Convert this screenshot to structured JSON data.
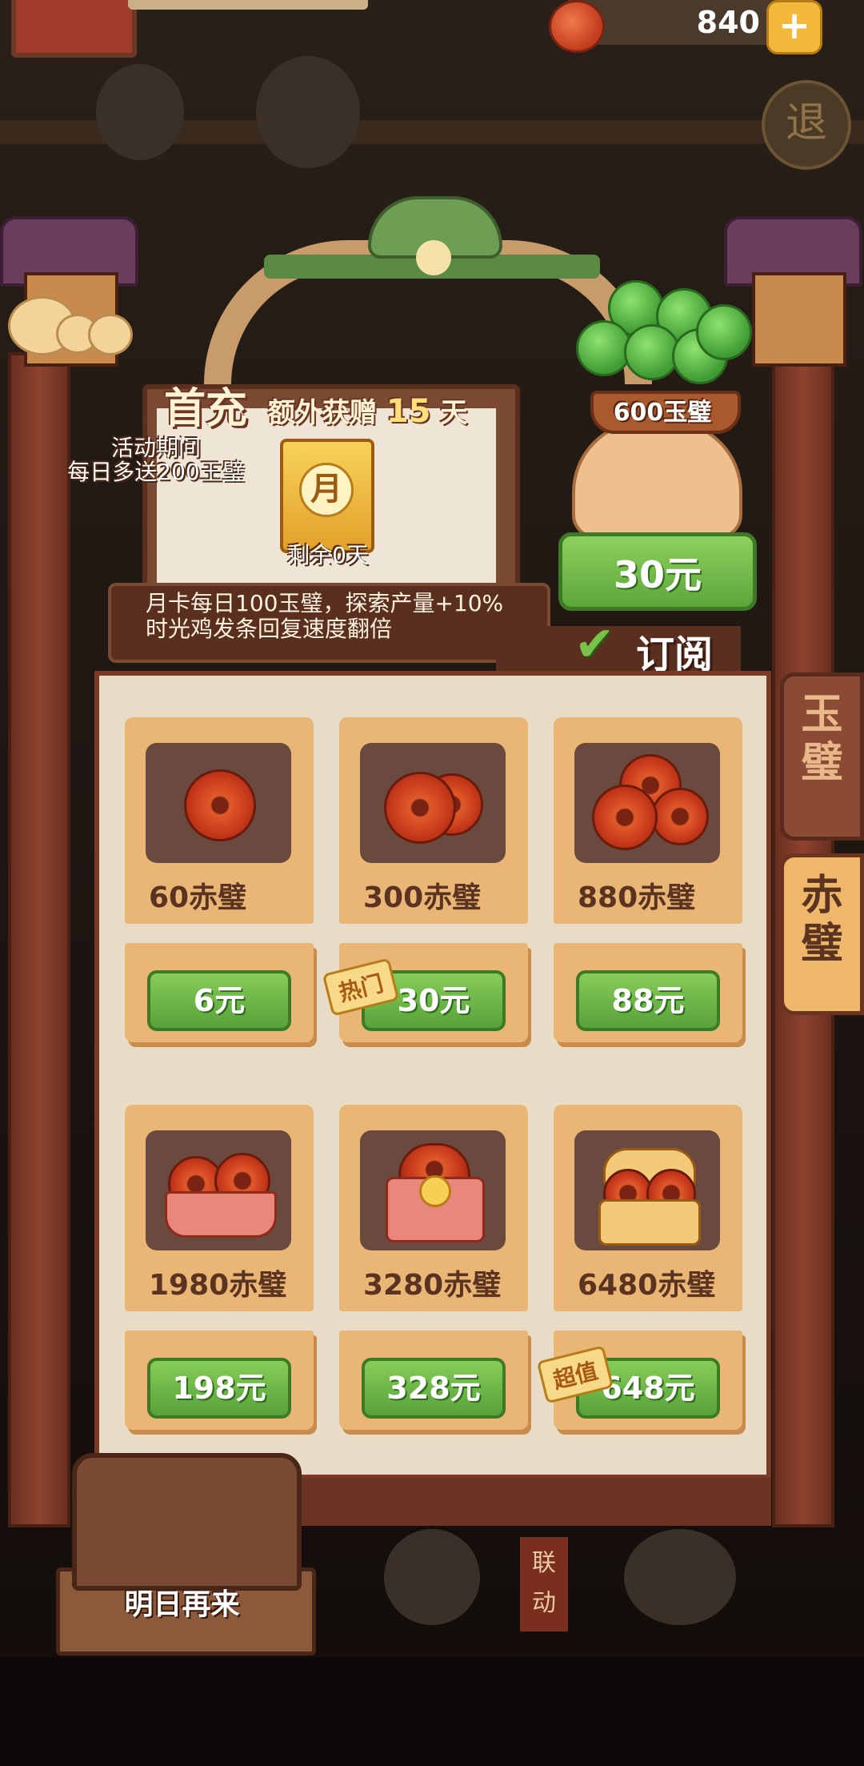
{
  "header": {
    "currency_amount": "840",
    "plus_label": "+",
    "exit_label": "退"
  },
  "first_charge": {
    "title": "首充",
    "extra": "额外获赠",
    "days": "15",
    "day_unit": "天",
    "event_note_line1": "活动期间",
    "event_note_line2": "每日多送200玉璧",
    "card_char": "月",
    "remaining": "剩余0天",
    "benefit_line1": "月卡每日100玉璧，探索产量+10%",
    "benefit_line2": "时光鸡发条回复速度翻倍"
  },
  "monthly": {
    "jade_amount": "600玉璧",
    "price": "30元",
    "subscribe_label": "订阅"
  },
  "shop": {
    "items": [
      {
        "name": "60赤璧",
        "price": "6元",
        "icon": "single-coin-icon"
      },
      {
        "name": "300赤璧",
        "price": "30元",
        "icon": "coin-pair-icon",
        "tag": "热门"
      },
      {
        "name": "880赤璧",
        "price": "88元",
        "icon": "coin-stack-icon"
      },
      {
        "name": "1980赤璧",
        "price": "198元",
        "icon": "coin-basket-icon"
      },
      {
        "name": "3280赤璧",
        "price": "328元",
        "icon": "gift-box-icon"
      },
      {
        "name": "6480赤璧",
        "price": "648元",
        "icon": "treasure-chest-icon",
        "tag": "超值"
      }
    ]
  },
  "side_tabs": {
    "jade_tab": "玉璧",
    "red_tab": "赤璧"
  },
  "footer": {
    "come_back_label": "明日再来",
    "collab_label": "联动"
  },
  "colors": {
    "accent_green": "#5ca63a",
    "card_tan": "#eab676",
    "frame_red": "#7a3a26",
    "selected_tab": "#efb769"
  }
}
